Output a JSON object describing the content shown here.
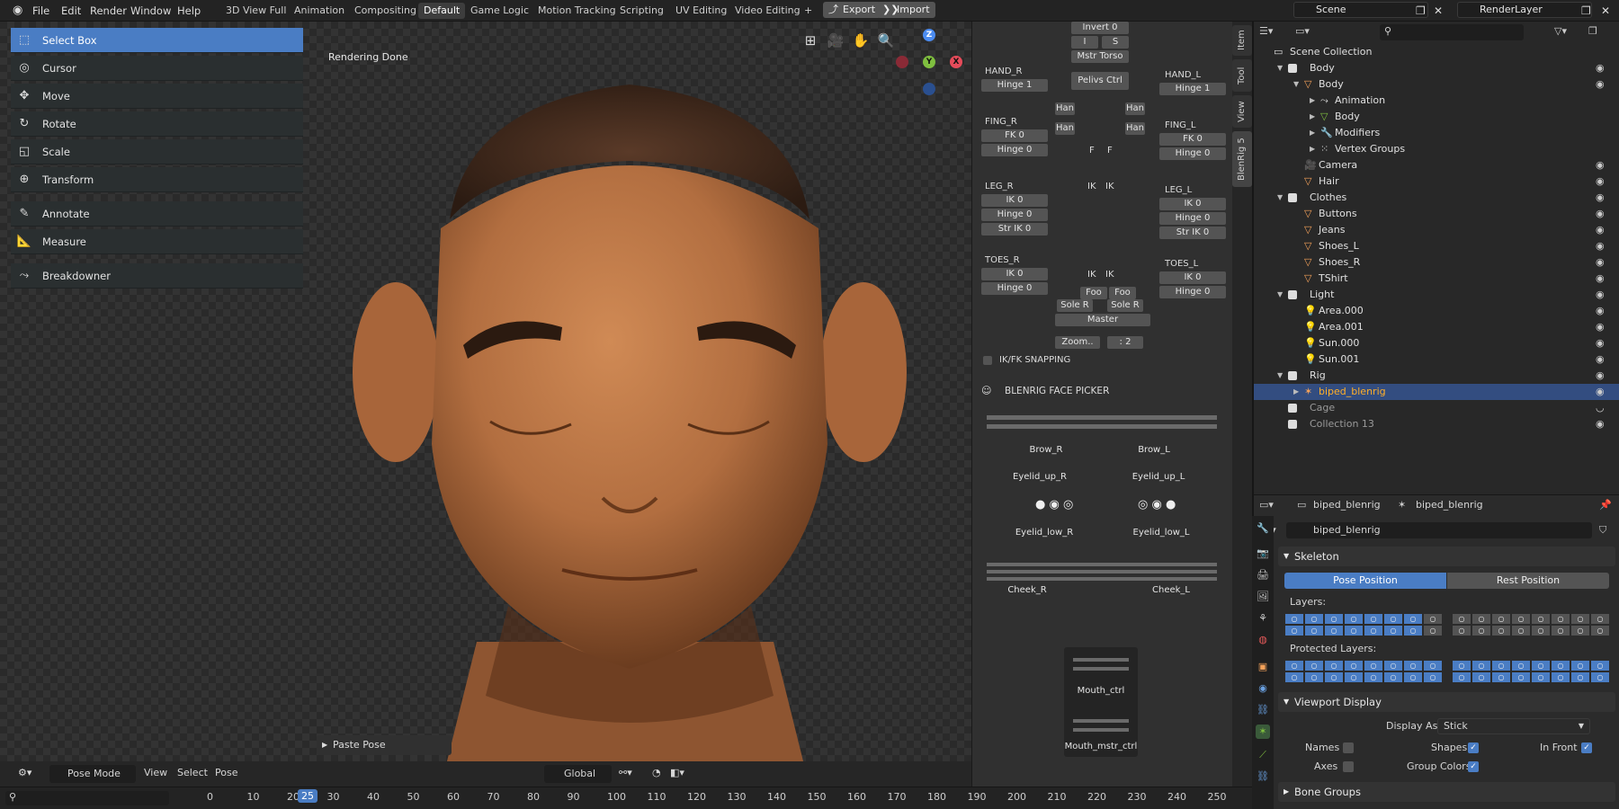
{
  "menu": {
    "file": "File",
    "edit": "Edit",
    "render": "Render",
    "window": "Window",
    "help": "Help"
  },
  "workspaces": [
    "3D View Full",
    "Animation",
    "Compositing",
    "Default",
    "Game Logic",
    "Motion Tracking",
    "Scripting",
    "UV Editing",
    "Video Editing"
  ],
  "workspace_add": "+",
  "export_label": "Export",
  "import_label": "Import",
  "scene_name": "Scene",
  "view_layer": "RenderLayer",
  "tools": [
    "Select Box",
    "Cursor",
    "Move",
    "Rotate",
    "Scale",
    "Transform",
    "Annotate",
    "Measure",
    "Breakdowner"
  ],
  "viewport_status": "Rendering Done",
  "gizmo": {
    "z": "Z",
    "y": "Y",
    "x": "X"
  },
  "last_op": "Paste Pose",
  "viewport_header": {
    "mode": "Pose Mode",
    "view": "View",
    "select": "Select",
    "pose": "Pose",
    "orientation": "Global"
  },
  "picker": {
    "top_buttons": [
      "Invert 0",
      "I",
      "S",
      "Mstr Torso",
      "Pelivs Ctrl"
    ],
    "hand_r": "HAND_R",
    "hand_r_hinge": "Hinge 1",
    "hand_l": "HAND_L",
    "hand_l_hinge": "Hinge 1",
    "fing_r": "FING_R",
    "fing_r_fk": "FK 0",
    "fing_r_hinge": "Hinge 0",
    "fing_l": "FING_L",
    "fing_l_fk": "FK 0",
    "fing_l_hinge": "Hinge 0",
    "leg_r": "LEG_R",
    "leg_r_ik": "IK 0",
    "leg_r_hinge": "Hinge 0",
    "leg_r_str": "Str IK 0",
    "leg_l": "LEG_L",
    "leg_l_ik": "IK 0",
    "leg_l_hinge": "Hinge 0",
    "leg_l_str": "Str IK 0",
    "toes_r": "TOES_R",
    "toes_r_ik": "IK 0",
    "toes_r_hinge": "Hinge 0",
    "toes_l": "TOES_L",
    "toes_l_ik": "IK 0",
    "toes_l_hinge": "Hinge 0",
    "han": "Han",
    "sole_r": "Sole R",
    "foo": "Foo",
    "master": "Master",
    "zoom": "Zoom..",
    "zoom_val": ": 2",
    "ikfk": "IK/FK SNAPPING",
    "face_title": "BLENRIG FACE PICKER",
    "brow_r": "Brow_R",
    "brow_l": "Brow_L",
    "eyelid_up_r": "Eyelid_up_R",
    "eyelid_up_l": "Eyelid_up_L",
    "eyelid_low_r": "Eyelid_low_R",
    "eyelid_low_l": "Eyelid_low_L",
    "cheek_r": "Cheek_R",
    "cheek_l": "Cheek_L",
    "mouth_ctrl": "Mouth_ctrl",
    "mouth_mstr": "Mouth_mstr_ctrl",
    "letters": {
      "f": "F",
      "ik": "IK"
    }
  },
  "sidetabs": [
    "Item",
    "Tool",
    "View",
    "BlenRig 5"
  ],
  "outliner": {
    "search_placeholder": "",
    "rows": [
      "Scene Collection",
      "Body",
      "Body",
      "Animation",
      "Body",
      "Modifiers",
      "Vertex Groups",
      "Camera",
      "Hair",
      "Clothes",
      "Buttons",
      "Jeans",
      "Shoes_L",
      "Shoes_R",
      "TShirt",
      "Light",
      "Area.000",
      "Area.001",
      "Sun.000",
      "Sun.001",
      "Rig",
      "biped_blenrig",
      "Cage",
      "Collection 13"
    ]
  },
  "properties": {
    "context1": "biped_blenrig",
    "context2": "biped_blenrig",
    "data_name": "biped_blenrig",
    "skeleton": "Skeleton",
    "pose_position": "Pose Position",
    "rest_position": "Rest Position",
    "layers": "Layers:",
    "protected_layers": "Protected Layers:",
    "viewport_display": "Viewport Display",
    "display_as_label": "Display As",
    "display_as_value": "Stick",
    "names": "Names",
    "shapes": "Shapes",
    "in_front": "In Front",
    "axes": "Axes",
    "group_colors": "Group Colors",
    "bone_groups": "Bone Groups"
  },
  "timeline": {
    "current_frame": "25",
    "ticks": [
      "0",
      "10",
      "20",
      "30",
      "40",
      "50",
      "60",
      "70",
      "80",
      "90",
      "100",
      "110",
      "120",
      "130",
      "140",
      "150",
      "160",
      "170",
      "180",
      "190",
      "200",
      "210",
      "220",
      "230",
      "240",
      "250"
    ]
  },
  "colors": {
    "accent": "#4a7dc4",
    "selected_orange": "#ffaf29",
    "skin": "#b9774a"
  }
}
